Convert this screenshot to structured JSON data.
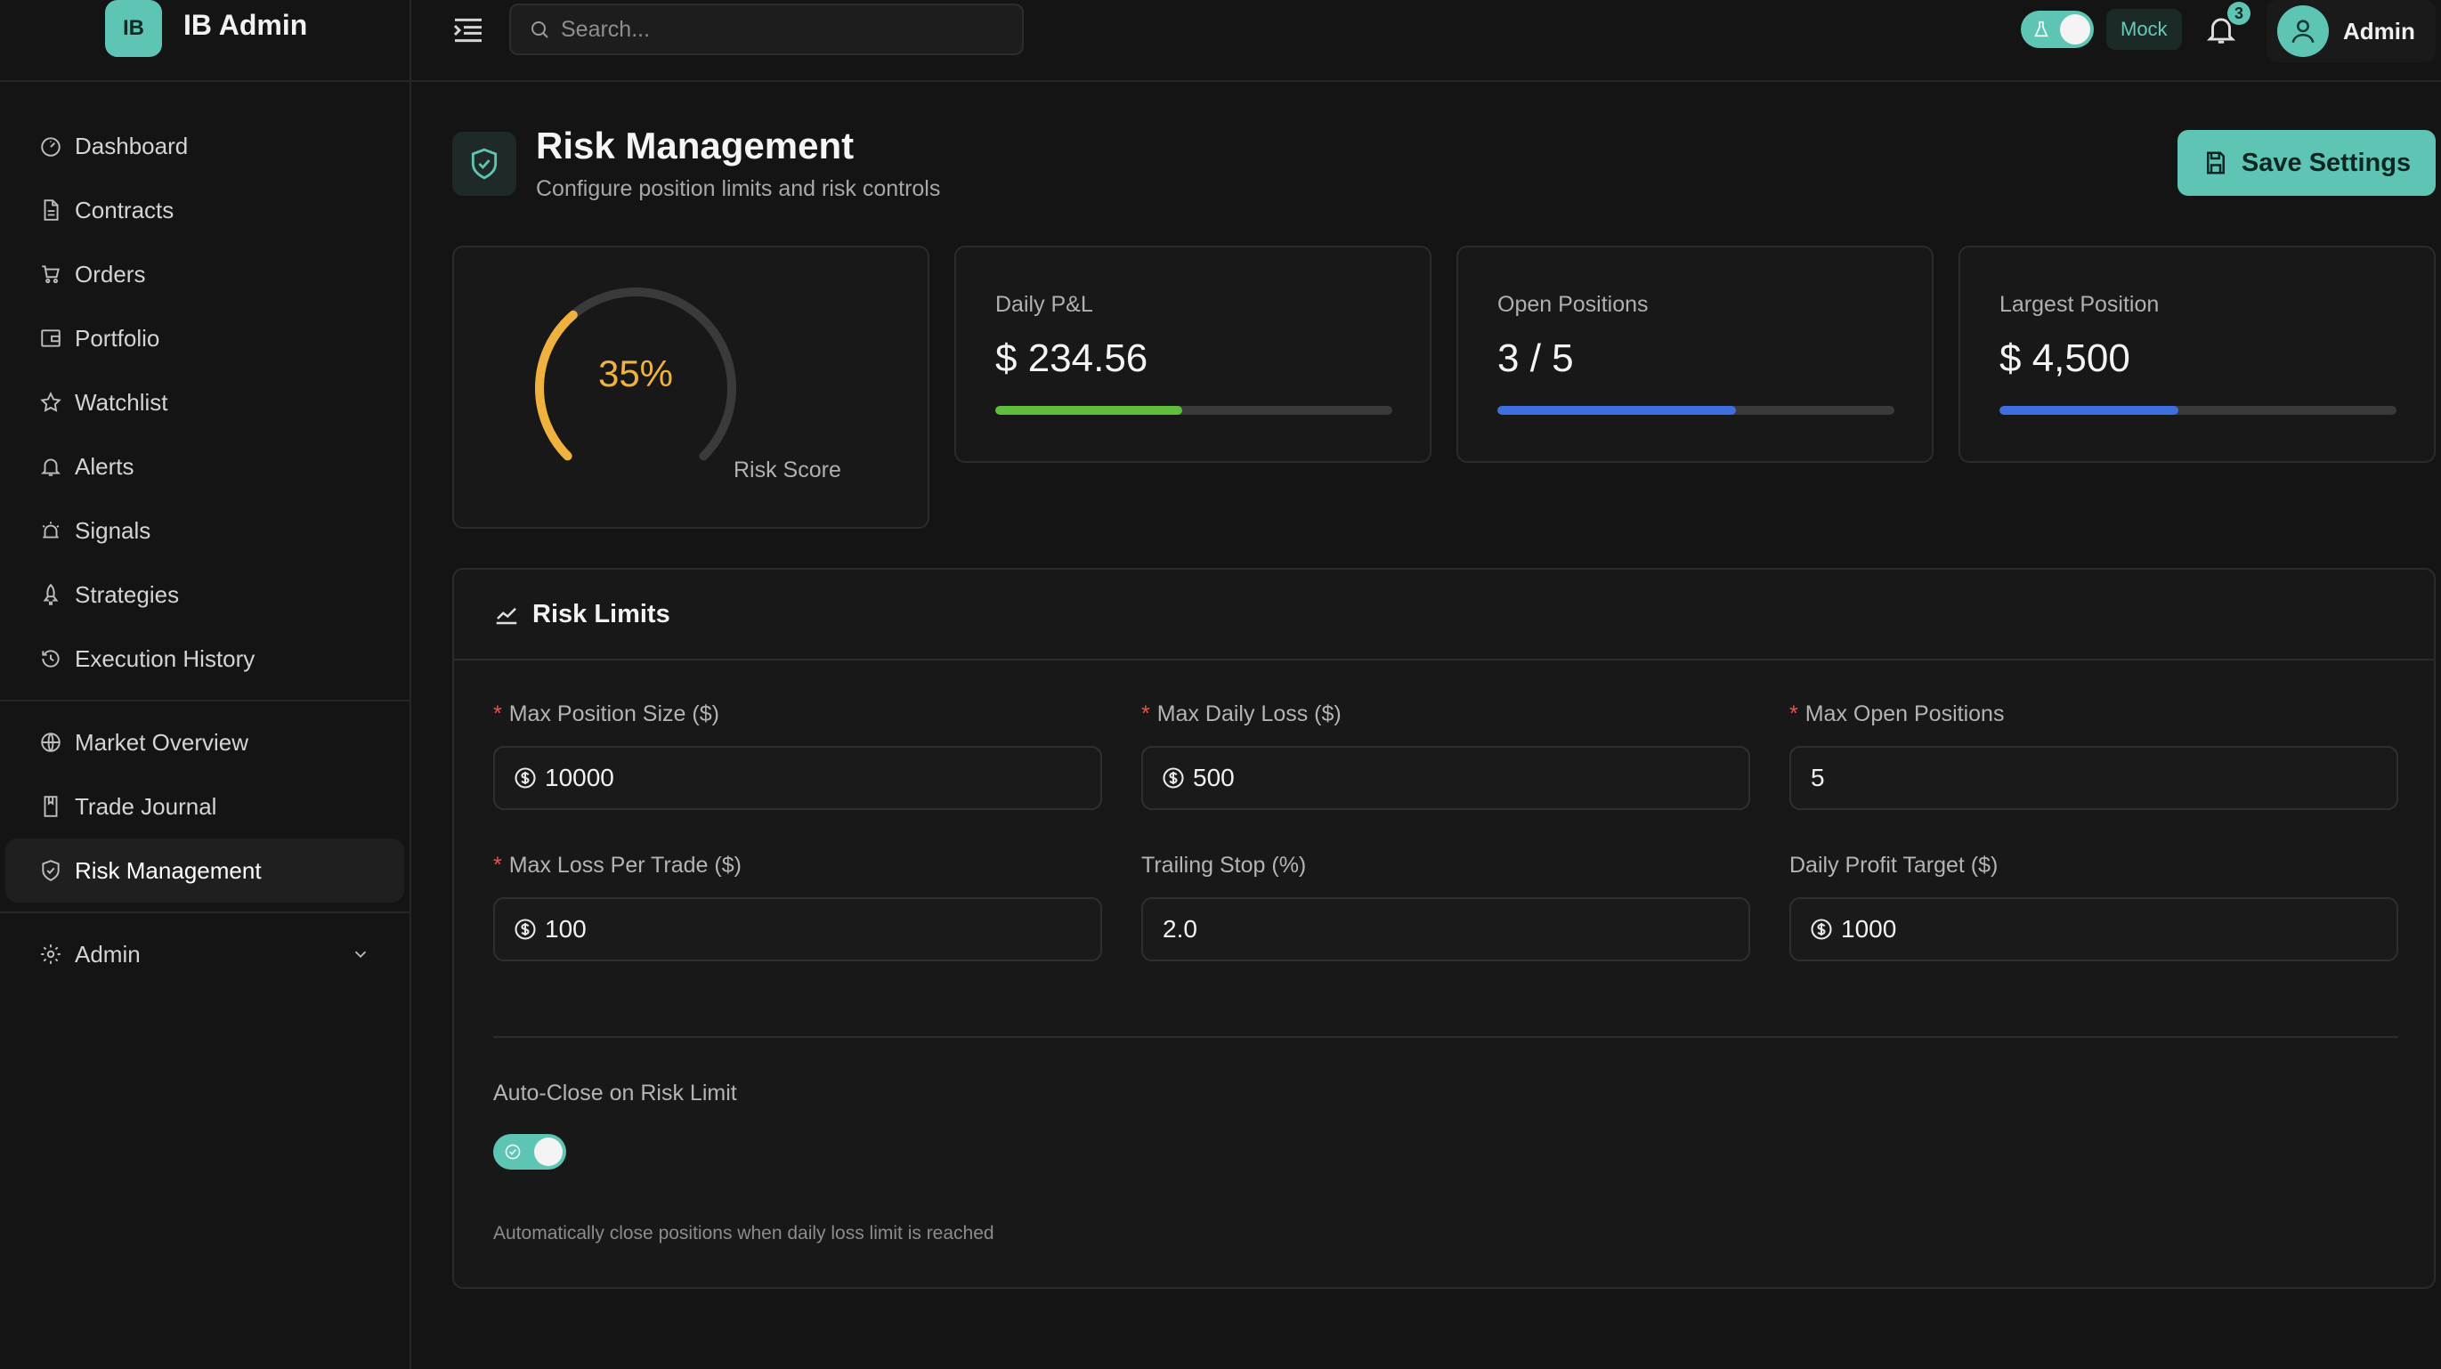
{
  "brand": {
    "logo_text": "IB",
    "name": "IB Admin"
  },
  "sidebar": {
    "items": [
      {
        "label": "Dashboard",
        "icon": "dashboard-icon"
      },
      {
        "label": "Contracts",
        "icon": "file-icon"
      },
      {
        "label": "Orders",
        "icon": "cart-icon"
      },
      {
        "label": "Portfolio",
        "icon": "wallet-icon"
      },
      {
        "label": "Watchlist",
        "icon": "star-icon"
      },
      {
        "label": "Alerts",
        "icon": "bell-icon"
      },
      {
        "label": "Signals",
        "icon": "alarm-icon"
      },
      {
        "label": "Strategies",
        "icon": "rocket-icon"
      },
      {
        "label": "Execution History",
        "icon": "history-icon"
      }
    ],
    "items2": [
      {
        "label": "Market Overview",
        "icon": "globe-icon"
      },
      {
        "label": "Trade Journal",
        "icon": "book-icon"
      },
      {
        "label": "Risk Management",
        "icon": "shield-icon",
        "active": true
      }
    ],
    "admin": {
      "label": "Admin",
      "icon": "gear-icon"
    }
  },
  "header": {
    "search_placeholder": "Search...",
    "mode_label": "Mock",
    "notification_count": "3",
    "user_name": "Admin"
  },
  "page": {
    "title": "Risk Management",
    "subtitle": "Configure position limits and risk controls",
    "save_label": "Save Settings"
  },
  "risk_score": {
    "value_text": "35%",
    "value": 0.35,
    "label": "Risk Score",
    "color": "#f0b23e"
  },
  "stats": [
    {
      "label": "Daily P&L",
      "value": "$ 234.56",
      "progress": 0.47,
      "color": "#5fbf3d"
    },
    {
      "label": "Open Positions",
      "value": "3 / 5",
      "progress": 0.6,
      "color": "#3d6fe0"
    },
    {
      "label": "Largest Position",
      "value": "$ 4,500",
      "progress": 0.45,
      "color": "#3d6fe0"
    }
  ],
  "limits": {
    "title": "Risk Limits",
    "fields": [
      {
        "label": "Max Position Size ($)",
        "required": "*",
        "value": "10000",
        "currency": true
      },
      {
        "label": "Max Daily Loss ($)",
        "required": "*",
        "value": "500",
        "currency": true
      },
      {
        "label": "Max Open Positions",
        "required": "*",
        "value": "5",
        "currency": false
      },
      {
        "label": "Max Loss Per Trade ($)",
        "required": "*",
        "value": "100",
        "currency": true
      },
      {
        "label": "Trailing Stop (%)",
        "required": "",
        "value": "2.0",
        "currency": false
      },
      {
        "label": "Daily Profit Target ($)",
        "required": "",
        "value": "1000",
        "currency": true
      }
    ],
    "auto_close_label": "Auto-Close on Risk Limit",
    "auto_close_enabled": true,
    "auto_close_help": "Automatically close positions when daily loss limit is reached"
  },
  "colors": {
    "accent": "#5ec4b4",
    "background": "#141414",
    "card": "#181818",
    "required": "#e0584f"
  }
}
